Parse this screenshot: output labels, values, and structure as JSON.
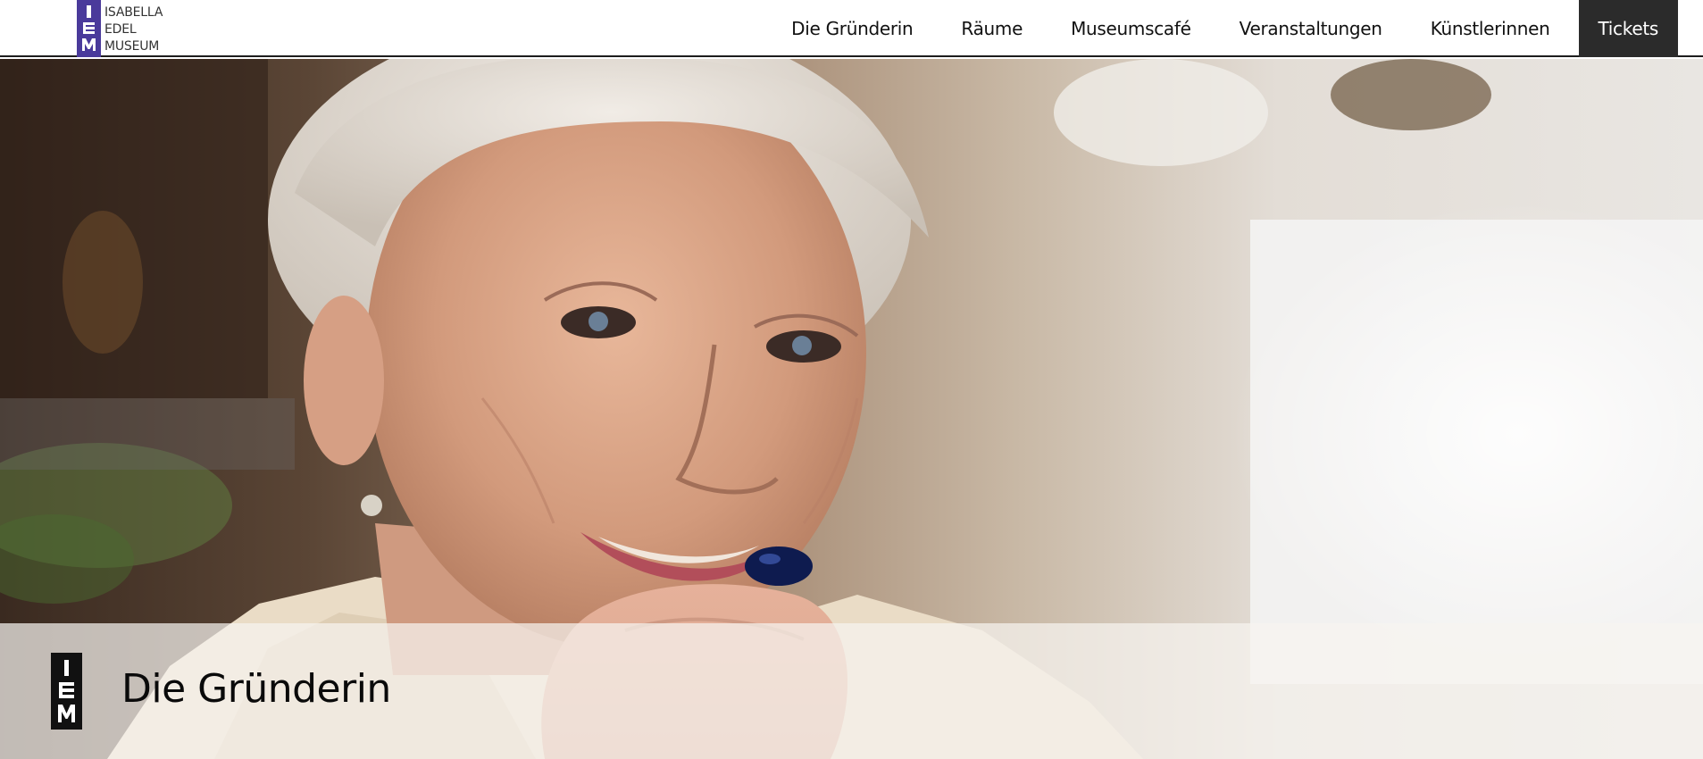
{
  "logo": {
    "lines": [
      "ISABELLA",
      "EDEL",
      "MUSEUM"
    ],
    "brand_color": "#4a3a9b"
  },
  "nav": {
    "items": [
      "Die Gründerin",
      "Räume",
      "Museumscafé",
      "Veranstaltungen",
      "Künstlerinnen"
    ],
    "tickets_label": "Tickets",
    "tickets_bg": "#2b2b2b"
  },
  "hero": {
    "image": "portrait-photo-smiling-elderly-woman"
  },
  "page": {
    "title": "Die Gründerin",
    "title_icon": "iem-logo-icon"
  }
}
